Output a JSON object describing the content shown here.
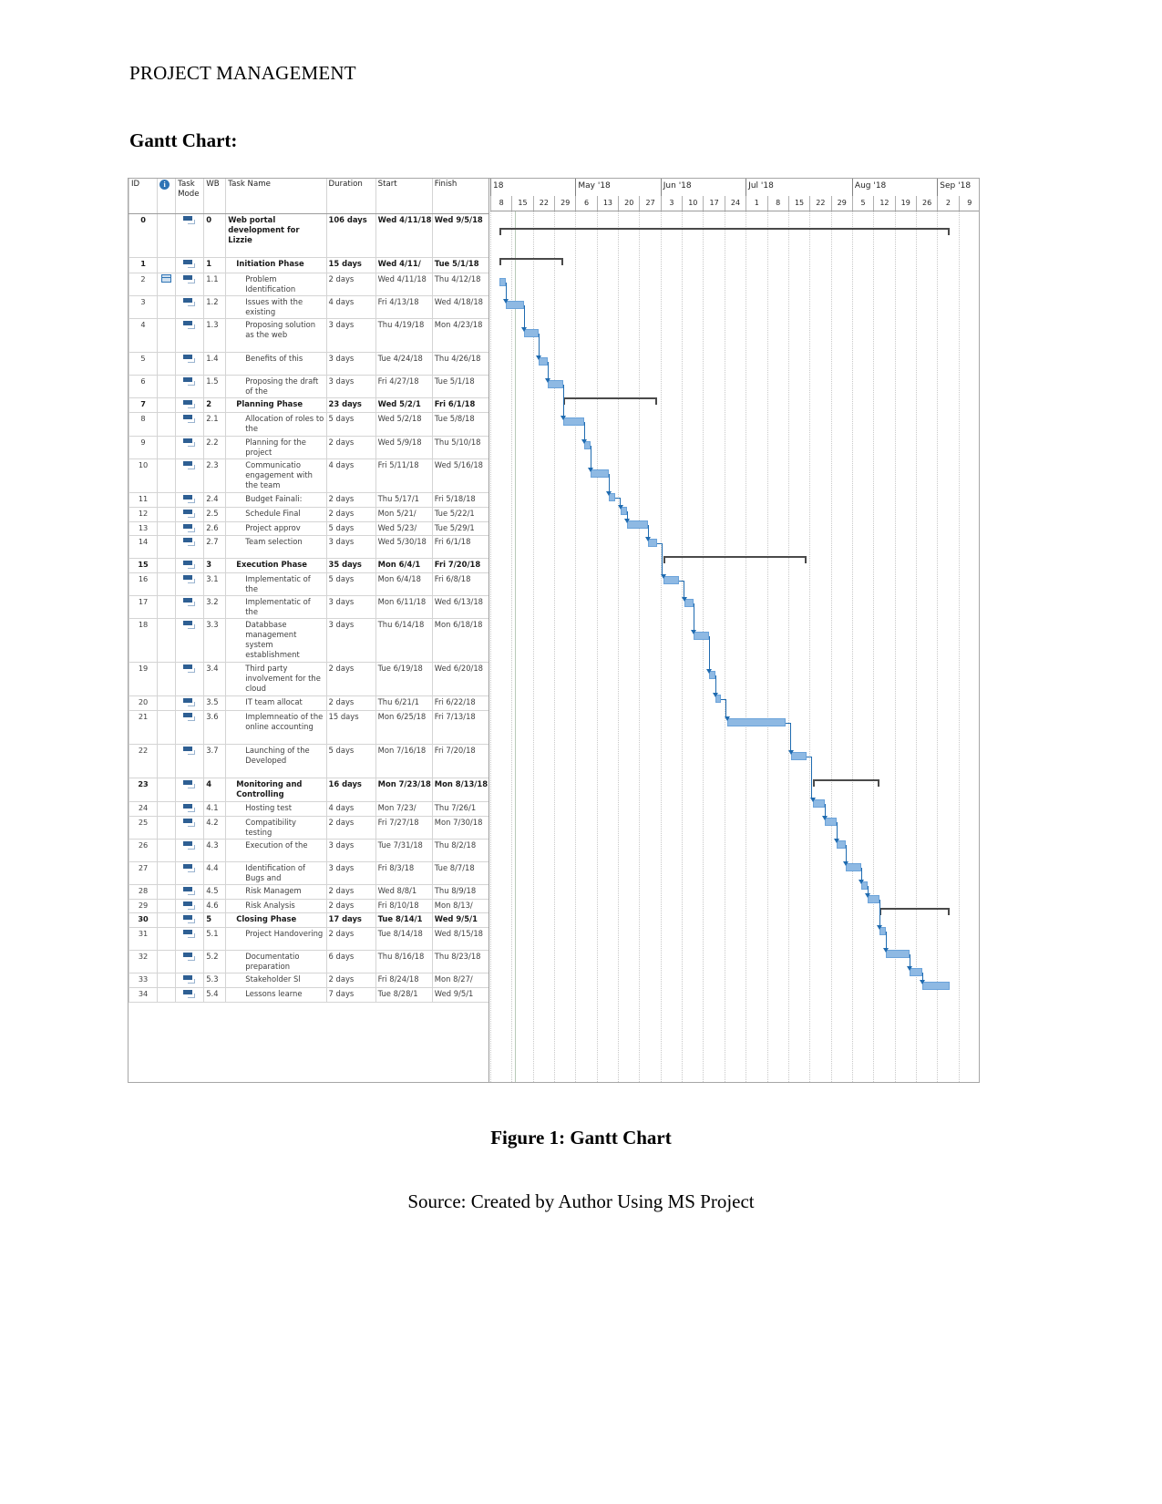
{
  "document": {
    "header": "PROJECT MANAGEMENT",
    "section_title": "Gantt Chart:",
    "figure_caption": "Figure 1: Gantt Chart",
    "figure_source": "Source: Created by Author Using MS Project"
  },
  "gantt": {
    "columns": {
      "id": "ID",
      "indicator": "",
      "task_mode": "Task Mode",
      "wbs": "WB",
      "task_name": "Task Name",
      "duration": "Duration",
      "start": "Start",
      "finish": "Finish"
    },
    "icons": {
      "info": "info-icon",
      "note": "note-icon",
      "mode": "manually-scheduled-icon"
    },
    "timeline": {
      "months": [
        "18",
        "May '18",
        "Jun '18",
        "Jul '18",
        "Aug '18",
        "Sep '18"
      ],
      "weeks": [
        "8",
        "15",
        "22",
        "29",
        "6",
        "13",
        "20",
        "27",
        "3",
        "10",
        "17",
        "24",
        "1",
        "8",
        "15",
        "22",
        "29",
        "5",
        "12",
        "19",
        "26",
        "2",
        "9"
      ]
    },
    "rows": [
      {
        "id": "0",
        "wbs": "0",
        "name": "Web portal development for Lizzie",
        "duration": "106 days",
        "start": "Wed 4/11/18",
        "finish": "Wed 9/5/18",
        "level": 0,
        "summary": true,
        "note": false
      },
      {
        "id": "1",
        "wbs": "1",
        "name": "Initiation Phase",
        "duration": "15 days",
        "start": "Wed 4/11/",
        "finish": "Tue 5/1/18",
        "level": 1,
        "summary": true,
        "note": false
      },
      {
        "id": "2",
        "wbs": "1.1",
        "name": "Problem Identification",
        "duration": "2 days",
        "start": "Wed 4/11/18",
        "finish": "Thu 4/12/18",
        "level": 2,
        "summary": false,
        "note": true
      },
      {
        "id": "3",
        "wbs": "1.2",
        "name": "Issues with the existing",
        "duration": "4 days",
        "start": "Fri 4/13/18",
        "finish": "Wed 4/18/18",
        "level": 2,
        "summary": false,
        "note": false
      },
      {
        "id": "4",
        "wbs": "1.3",
        "name": "Proposing solution as the web",
        "duration": "3 days",
        "start": "Thu 4/19/18",
        "finish": "Mon 4/23/18",
        "level": 2,
        "summary": false,
        "note": false
      },
      {
        "id": "5",
        "wbs": "1.4",
        "name": "Benefits of this",
        "duration": "3 days",
        "start": "Tue 4/24/18",
        "finish": "Thu 4/26/18",
        "level": 2,
        "summary": false,
        "note": false
      },
      {
        "id": "6",
        "wbs": "1.5",
        "name": "Proposing the draft of the",
        "duration": "3 days",
        "start": "Fri 4/27/18",
        "finish": "Tue 5/1/18",
        "level": 2,
        "summary": false,
        "note": false
      },
      {
        "id": "7",
        "wbs": "2",
        "name": "Planning Phase",
        "duration": "23 days",
        "start": "Wed 5/2/1",
        "finish": "Fri 6/1/18",
        "level": 1,
        "summary": true,
        "note": false
      },
      {
        "id": "8",
        "wbs": "2.1",
        "name": "Allocation of roles to the",
        "duration": "5 days",
        "start": "Wed 5/2/18",
        "finish": "Tue 5/8/18",
        "level": 2,
        "summary": false,
        "note": false
      },
      {
        "id": "9",
        "wbs": "2.2",
        "name": "Planning for the project",
        "duration": "2 days",
        "start": "Wed 5/9/18",
        "finish": "Thu 5/10/18",
        "level": 2,
        "summary": false,
        "note": false
      },
      {
        "id": "10",
        "wbs": "2.3",
        "name": "Communicatio engagement with the team",
        "duration": "4 days",
        "start": "Fri 5/11/18",
        "finish": "Wed 5/16/18",
        "level": 2,
        "summary": false,
        "note": false
      },
      {
        "id": "11",
        "wbs": "2.4",
        "name": "Budget Fainali:",
        "duration": "2 days",
        "start": "Thu 5/17/1",
        "finish": "Fri 5/18/18",
        "level": 2,
        "summary": false,
        "note": false
      },
      {
        "id": "12",
        "wbs": "2.5",
        "name": "Schedule Final",
        "duration": "2 days",
        "start": "Mon 5/21/",
        "finish": "Tue 5/22/1",
        "level": 2,
        "summary": false,
        "note": false
      },
      {
        "id": "13",
        "wbs": "2.6",
        "name": "Project approv",
        "duration": "5 days",
        "start": "Wed 5/23/",
        "finish": "Tue 5/29/1",
        "level": 2,
        "summary": false,
        "note": false
      },
      {
        "id": "14",
        "wbs": "2.7",
        "name": "Team selection",
        "duration": "3 days",
        "start": "Wed 5/30/18",
        "finish": "Fri 6/1/18",
        "level": 2,
        "summary": false,
        "note": false
      },
      {
        "id": "15",
        "wbs": "3",
        "name": "Execution Phase",
        "duration": "35 days",
        "start": "Mon 6/4/1",
        "finish": "Fri 7/20/18",
        "level": 1,
        "summary": true,
        "note": false
      },
      {
        "id": "16",
        "wbs": "3.1",
        "name": "Implementatic of the",
        "duration": "5 days",
        "start": "Mon 6/4/18",
        "finish": "Fri 6/8/18",
        "level": 2,
        "summary": false,
        "note": false
      },
      {
        "id": "17",
        "wbs": "3.2",
        "name": "Implementatic of the",
        "duration": "3 days",
        "start": "Mon 6/11/18",
        "finish": "Wed 6/13/18",
        "level": 2,
        "summary": false,
        "note": false
      },
      {
        "id": "18",
        "wbs": "3.3",
        "name": "Databbase management system establishment",
        "duration": "3 days",
        "start": "Thu 6/14/18",
        "finish": "Mon 6/18/18",
        "level": 2,
        "summary": false,
        "note": false
      },
      {
        "id": "19",
        "wbs": "3.4",
        "name": "Third party involvement for the cloud",
        "duration": "2 days",
        "start": "Tue 6/19/18",
        "finish": "Wed 6/20/18",
        "level": 2,
        "summary": false,
        "note": false
      },
      {
        "id": "20",
        "wbs": "3.5",
        "name": "IT team allocat",
        "duration": "2 days",
        "start": "Thu 6/21/1",
        "finish": "Fri 6/22/18",
        "level": 2,
        "summary": false,
        "note": false
      },
      {
        "id": "21",
        "wbs": "3.6",
        "name": "Implemneatio of the online accounting",
        "duration": "15 days",
        "start": "Mon 6/25/18",
        "finish": "Fri 7/13/18",
        "level": 2,
        "summary": false,
        "note": false
      },
      {
        "id": "22",
        "wbs": "3.7",
        "name": "Launching of the Developed",
        "duration": "5 days",
        "start": "Mon 7/16/18",
        "finish": "Fri 7/20/18",
        "level": 2,
        "summary": false,
        "note": false
      },
      {
        "id": "23",
        "wbs": "4",
        "name": "Monitoring and Controlling",
        "duration": "16 days",
        "start": "Mon 7/23/18",
        "finish": "Mon 8/13/18",
        "level": 1,
        "summary": true,
        "note": false
      },
      {
        "id": "24",
        "wbs": "4.1",
        "name": "Hosting test",
        "duration": "4 days",
        "start": "Mon 7/23/",
        "finish": "Thu 7/26/1",
        "level": 2,
        "summary": false,
        "note": false
      },
      {
        "id": "25",
        "wbs": "4.2",
        "name": "Compatibility testing",
        "duration": "2 days",
        "start": "Fri 7/27/18",
        "finish": "Mon 7/30/18",
        "level": 2,
        "summary": false,
        "note": false
      },
      {
        "id": "26",
        "wbs": "4.3",
        "name": "Execution of the",
        "duration": "3 days",
        "start": "Tue 7/31/18",
        "finish": "Thu 8/2/18",
        "level": 2,
        "summary": false,
        "note": false
      },
      {
        "id": "27",
        "wbs": "4.4",
        "name": "Identification of Bugs and",
        "duration": "3 days",
        "start": "Fri 8/3/18",
        "finish": "Tue 8/7/18",
        "level": 2,
        "summary": false,
        "note": false
      },
      {
        "id": "28",
        "wbs": "4.5",
        "name": "Risk Managem",
        "duration": "2 days",
        "start": "Wed 8/8/1",
        "finish": "Thu 8/9/18",
        "level": 2,
        "summary": false,
        "note": false
      },
      {
        "id": "29",
        "wbs": "4.6",
        "name": "Risk Analysis",
        "duration": "2 days",
        "start": "Fri 8/10/18",
        "finish": "Mon 8/13/",
        "level": 2,
        "summary": false,
        "note": false
      },
      {
        "id": "30",
        "wbs": "5",
        "name": "Closing Phase",
        "duration": "17 days",
        "start": "Tue 8/14/1",
        "finish": "Wed 9/5/1",
        "level": 1,
        "summary": true,
        "note": false
      },
      {
        "id": "31",
        "wbs": "5.1",
        "name": "Project Handovering",
        "duration": "2 days",
        "start": "Tue 8/14/18",
        "finish": "Wed 8/15/18",
        "level": 2,
        "summary": false,
        "note": false
      },
      {
        "id": "32",
        "wbs": "5.2",
        "name": "Documentatio preparation",
        "duration": "6 days",
        "start": "Thu 8/16/18",
        "finish": "Thu 8/23/18",
        "level": 2,
        "summary": false,
        "note": false
      },
      {
        "id": "33",
        "wbs": "5.3",
        "name": "Stakeholder Sl",
        "duration": "2 days",
        "start": "Fri 8/24/18",
        "finish": "Mon 8/27/",
        "level": 2,
        "summary": false,
        "note": false
      },
      {
        "id": "34",
        "wbs": "5.4",
        "name": "Lessons learne",
        "duration": "7 days",
        "start": "Tue 8/28/1",
        "finish": "Wed 9/5/1",
        "level": 2,
        "summary": false,
        "note": false
      }
    ],
    "chart_data": {
      "type": "bar",
      "title": "Gantt Chart",
      "orientation": "horizontal-timeline",
      "axis_start": "2018-04-08",
      "axis_end": "2018-09-09",
      "bars": [
        {
          "id": "0",
          "wbs": "0",
          "label": "Web portal development for Lizzie",
          "start": "2018-04-11",
          "finish": "2018-09-05",
          "days": 106,
          "kind": "summary"
        },
        {
          "id": "1",
          "wbs": "1",
          "label": "Initiation Phase",
          "start": "2018-04-11",
          "finish": "2018-05-01",
          "days": 15,
          "kind": "summary"
        },
        {
          "id": "2",
          "wbs": "1.1",
          "label": "Problem Identification",
          "start": "2018-04-11",
          "finish": "2018-04-12",
          "days": 2,
          "kind": "task"
        },
        {
          "id": "3",
          "wbs": "1.2",
          "label": "Issues with the existing",
          "start": "2018-04-13",
          "finish": "2018-04-18",
          "days": 4,
          "kind": "task"
        },
        {
          "id": "4",
          "wbs": "1.3",
          "label": "Proposing solution as the web",
          "start": "2018-04-19",
          "finish": "2018-04-23",
          "days": 3,
          "kind": "task"
        },
        {
          "id": "5",
          "wbs": "1.4",
          "label": "Benefits of this",
          "start": "2018-04-24",
          "finish": "2018-04-26",
          "days": 3,
          "kind": "task"
        },
        {
          "id": "6",
          "wbs": "1.5",
          "label": "Proposing the draft of the",
          "start": "2018-04-27",
          "finish": "2018-05-01",
          "days": 3,
          "kind": "task"
        },
        {
          "id": "7",
          "wbs": "2",
          "label": "Planning Phase",
          "start": "2018-05-02",
          "finish": "2018-06-01",
          "days": 23,
          "kind": "summary"
        },
        {
          "id": "8",
          "wbs": "2.1",
          "label": "Allocation of roles to the",
          "start": "2018-05-02",
          "finish": "2018-05-08",
          "days": 5,
          "kind": "task"
        },
        {
          "id": "9",
          "wbs": "2.2",
          "label": "Planning for the project",
          "start": "2018-05-09",
          "finish": "2018-05-10",
          "days": 2,
          "kind": "task"
        },
        {
          "id": "10",
          "wbs": "2.3",
          "label": "Communicatio engagement with the team",
          "start": "2018-05-11",
          "finish": "2018-05-16",
          "days": 4,
          "kind": "task"
        },
        {
          "id": "11",
          "wbs": "2.4",
          "label": "Budget Fainali:",
          "start": "2018-05-17",
          "finish": "2018-05-18",
          "days": 2,
          "kind": "task"
        },
        {
          "id": "12",
          "wbs": "2.5",
          "label": "Schedule Final",
          "start": "2018-05-21",
          "finish": "2018-05-22",
          "days": 2,
          "kind": "task"
        },
        {
          "id": "13",
          "wbs": "2.6",
          "label": "Project approv",
          "start": "2018-05-23",
          "finish": "2018-05-29",
          "days": 5,
          "kind": "task"
        },
        {
          "id": "14",
          "wbs": "2.7",
          "label": "Team selection",
          "start": "2018-05-30",
          "finish": "2018-06-01",
          "days": 3,
          "kind": "task"
        },
        {
          "id": "15",
          "wbs": "3",
          "label": "Execution Phase",
          "start": "2018-06-04",
          "finish": "2018-07-20",
          "days": 35,
          "kind": "summary"
        },
        {
          "id": "16",
          "wbs": "3.1",
          "label": "Implementatic of the",
          "start": "2018-06-04",
          "finish": "2018-06-08",
          "days": 5,
          "kind": "task"
        },
        {
          "id": "17",
          "wbs": "3.2",
          "label": "Implementatic of the",
          "start": "2018-06-11",
          "finish": "2018-06-13",
          "days": 3,
          "kind": "task"
        },
        {
          "id": "18",
          "wbs": "3.3",
          "label": "Databbase management system establishment",
          "start": "2018-06-14",
          "finish": "2018-06-18",
          "days": 3,
          "kind": "task"
        },
        {
          "id": "19",
          "wbs": "3.4",
          "label": "Third party involvement for the cloud",
          "start": "2018-06-19",
          "finish": "2018-06-20",
          "days": 2,
          "kind": "task"
        },
        {
          "id": "20",
          "wbs": "3.5",
          "label": "IT team allocat",
          "start": "2018-06-21",
          "finish": "2018-06-22",
          "days": 2,
          "kind": "task"
        },
        {
          "id": "21",
          "wbs": "3.6",
          "label": "Implemneatio of the online accounting",
          "start": "2018-06-25",
          "finish": "2018-07-13",
          "days": 15,
          "kind": "task"
        },
        {
          "id": "22",
          "wbs": "3.7",
          "label": "Launching of the Developed",
          "start": "2018-07-16",
          "finish": "2018-07-20",
          "days": 5,
          "kind": "task"
        },
        {
          "id": "23",
          "wbs": "4",
          "label": "Monitoring and Controlling",
          "start": "2018-07-23",
          "finish": "2018-08-13",
          "days": 16,
          "kind": "summary"
        },
        {
          "id": "24",
          "wbs": "4.1",
          "label": "Hosting test",
          "start": "2018-07-23",
          "finish": "2018-07-26",
          "days": 4,
          "kind": "task"
        },
        {
          "id": "25",
          "wbs": "4.2",
          "label": "Compatibility testing",
          "start": "2018-07-27",
          "finish": "2018-07-30",
          "days": 2,
          "kind": "task"
        },
        {
          "id": "26",
          "wbs": "4.3",
          "label": "Execution of the",
          "start": "2018-07-31",
          "finish": "2018-08-02",
          "days": 3,
          "kind": "task"
        },
        {
          "id": "27",
          "wbs": "4.4",
          "label": "Identification of Bugs and",
          "start": "2018-08-03",
          "finish": "2018-08-07",
          "days": 3,
          "kind": "task"
        },
        {
          "id": "28",
          "wbs": "4.5",
          "label": "Risk Managem",
          "start": "2018-08-08",
          "finish": "2018-08-09",
          "days": 2,
          "kind": "task"
        },
        {
          "id": "29",
          "wbs": "4.6",
          "label": "Risk Analysis",
          "start": "2018-08-10",
          "finish": "2018-08-13",
          "days": 2,
          "kind": "task"
        },
        {
          "id": "30",
          "wbs": "5",
          "label": "Closing Phase",
          "start": "2018-08-14",
          "finish": "2018-09-05",
          "days": 17,
          "kind": "summary"
        },
        {
          "id": "31",
          "wbs": "5.1",
          "label": "Project Handovering",
          "start": "2018-08-14",
          "finish": "2018-08-15",
          "days": 2,
          "kind": "task"
        },
        {
          "id": "32",
          "wbs": "5.2",
          "label": "Documentatio preparation",
          "start": "2018-08-16",
          "finish": "2018-08-23",
          "days": 6,
          "kind": "task"
        },
        {
          "id": "33",
          "wbs": "5.3",
          "label": "Stakeholder Sl",
          "start": "2018-08-24",
          "finish": "2018-08-27",
          "days": 2,
          "kind": "task"
        },
        {
          "id": "34",
          "wbs": "5.4",
          "label": "Lessons learne",
          "start": "2018-08-28",
          "finish": "2018-09-05",
          "days": 7,
          "kind": "task"
        }
      ],
      "colors": {
        "task_bar": "#8eb9e3",
        "task_bar_border": "#6ba3da",
        "summary_bar": "#4a4a4a",
        "link": "#1f6bb0"
      }
    }
  }
}
